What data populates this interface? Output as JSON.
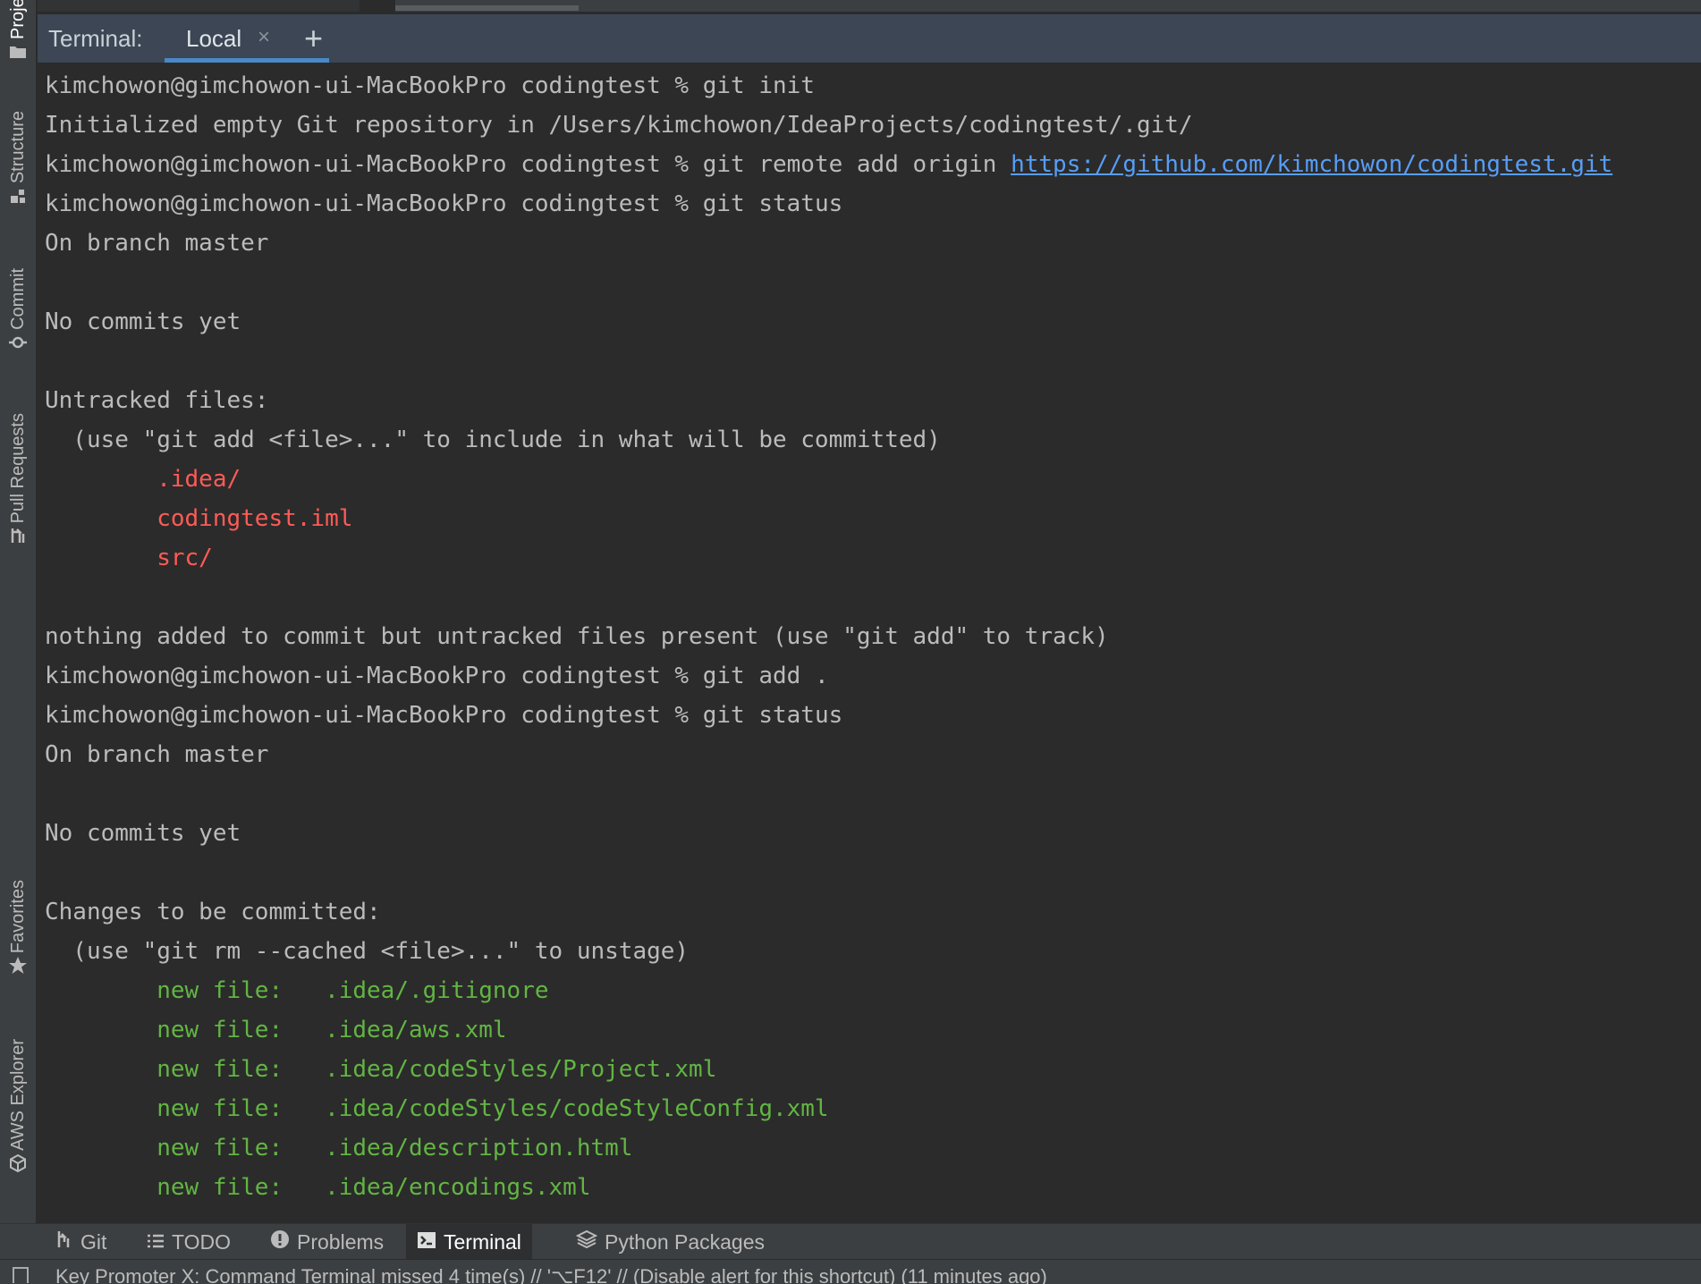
{
  "left_strip": {
    "tabs": [
      {
        "label": "Proje",
        "icon": "folder-icon"
      },
      {
        "label": "Structure",
        "icon": "structure-icon"
      },
      {
        "label": "Commit",
        "icon": "commit-icon"
      },
      {
        "label": "Pull Requests",
        "icon": "pull-request-icon"
      },
      {
        "label": "Favorites",
        "icon": "star-icon"
      },
      {
        "label": "AWS Explorer",
        "icon": "cube-icon"
      }
    ]
  },
  "terminal_tabs": {
    "title": "Terminal:",
    "active_tab": "Local",
    "close_glyph": "×",
    "add_glyph": "+"
  },
  "terminal": {
    "prompt": "kimchowon@gimchowon-ui-MacBookPro codingtest % ",
    "lines": [
      {
        "type": "cmd",
        "text": "git init"
      },
      {
        "type": "out",
        "text": "Initialized empty Git repository in /Users/kimchowon/IdeaProjects/codingtest/.git/"
      },
      {
        "type": "cmd",
        "text": "git remote add origin ",
        "link": "https://github.com/kimchowon/codingtest.git"
      },
      {
        "type": "cmd",
        "text": "git status"
      },
      {
        "type": "out",
        "text": "On branch master"
      },
      {
        "type": "out",
        "text": ""
      },
      {
        "type": "out",
        "text": "No commits yet"
      },
      {
        "type": "out",
        "text": ""
      },
      {
        "type": "out",
        "text": "Untracked files:"
      },
      {
        "type": "out",
        "text": "  (use \"git add <file>...\" to include in what will be committed)"
      },
      {
        "type": "red",
        "text": "        .idea/"
      },
      {
        "type": "red",
        "text": "        codingtest.iml"
      },
      {
        "type": "red",
        "text": "        src/"
      },
      {
        "type": "out",
        "text": ""
      },
      {
        "type": "out",
        "text": "nothing added to commit but untracked files present (use \"git add\" to track)"
      },
      {
        "type": "cmd",
        "text": "git add ."
      },
      {
        "type": "cmd",
        "text": "git status"
      },
      {
        "type": "out",
        "text": "On branch master"
      },
      {
        "type": "out",
        "text": ""
      },
      {
        "type": "out",
        "text": "No commits yet"
      },
      {
        "type": "out",
        "text": ""
      },
      {
        "type": "out",
        "text": "Changes to be committed:"
      },
      {
        "type": "out",
        "text": "  (use \"git rm --cached <file>...\" to unstage)"
      },
      {
        "type": "green",
        "text": "        new file:   .idea/.gitignore"
      },
      {
        "type": "green",
        "text": "        new file:   .idea/aws.xml"
      },
      {
        "type": "green",
        "text": "        new file:   .idea/codeStyles/Project.xml"
      },
      {
        "type": "green",
        "text": "        new file:   .idea/codeStyles/codeStyleConfig.xml"
      },
      {
        "type": "green",
        "text": "        new file:   .idea/description.html"
      },
      {
        "type": "green",
        "text": "        new file:   .idea/encodings.xml"
      }
    ]
  },
  "bottom_bar": {
    "items": [
      {
        "label": "Git",
        "icon": "git-branch-icon",
        "active": false
      },
      {
        "label": "TODO",
        "icon": "list-icon",
        "active": false
      },
      {
        "label": "Problems",
        "icon": "exclamation-icon",
        "active": false
      },
      {
        "label": "Terminal",
        "icon": "terminal-icon",
        "active": true
      },
      {
        "label": "Python Packages",
        "icon": "layers-icon",
        "active": false
      }
    ]
  },
  "status_bar": {
    "text": "Key Promoter X: Command Terminal missed 4 time(s) // '⌥F12' // (Disable alert for this shortcut) (11 minutes ago)"
  },
  "colors": {
    "background": "#2b2b2b",
    "text": "#bbbbbb",
    "untracked": "#ff5b57",
    "staged": "#62b543",
    "link": "#589df6",
    "tab_underline": "#4a88c7"
  }
}
